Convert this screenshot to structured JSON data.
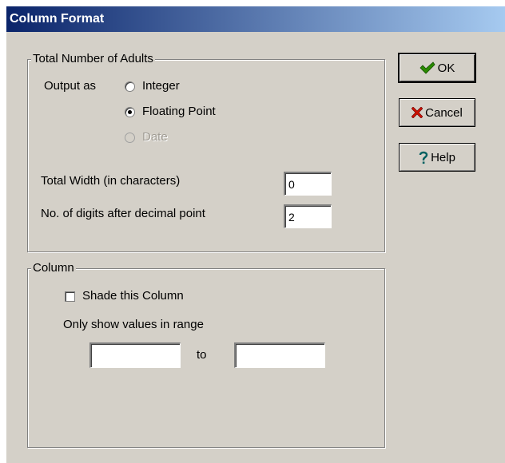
{
  "window": {
    "title": "Column Format"
  },
  "adults_group": {
    "legend": "Total Number of Adults",
    "output_as_label": "Output as",
    "options": [
      {
        "label": "Integer",
        "selected": false,
        "disabled": false
      },
      {
        "label": "Floating Point",
        "selected": true,
        "disabled": false
      },
      {
        "label": "Date",
        "selected": false,
        "disabled": true
      }
    ],
    "total_width_label": "Total Width (in characters)",
    "total_width_value": "0",
    "digits_label": "No. of digits after decimal point",
    "digits_value": "2"
  },
  "column_group": {
    "legend": "Column",
    "shade_label": "Shade this Column",
    "shade_checked": false,
    "range_label": "Only show values in range",
    "range_from": "",
    "range_to_label": "to",
    "range_to": ""
  },
  "buttons": {
    "ok_label": "OK",
    "cancel_label": "Cancel",
    "help_label": "Help"
  },
  "icons": {
    "ok": "checkmark-icon",
    "cancel": "red-x-icon",
    "help": "question-mark-icon"
  },
  "colors": {
    "titlebar_start": "#0a246a",
    "titlebar_end": "#a6caf0",
    "dialog_bg": "#d4d0c8",
    "ok_check": "#2a8a00",
    "cancel_x": "#cc1100"
  }
}
